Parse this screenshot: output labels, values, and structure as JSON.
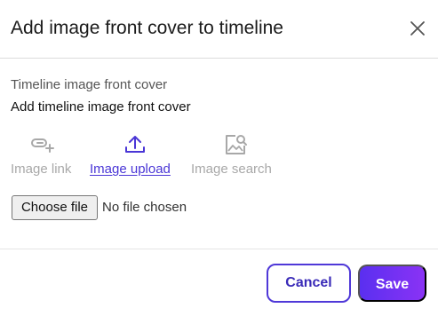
{
  "dialog": {
    "title": "Add image front cover to timeline",
    "close_icon": "close-icon"
  },
  "section": {
    "label": "Timeline image front cover",
    "description": "Add timeline image front cover"
  },
  "tabs": [
    {
      "label": "Image link",
      "icon": "link-add-icon",
      "active": false
    },
    {
      "label": "Image upload",
      "icon": "upload-icon",
      "active": true
    },
    {
      "label": "Image search",
      "icon": "image-search-icon",
      "active": false
    }
  ],
  "file_input": {
    "button_label": "Choose file",
    "status": "No file chosen"
  },
  "footer": {
    "cancel_label": "Cancel",
    "save_label": "Save"
  },
  "colors": {
    "accent": "#4a36d6",
    "save_gradient_start": "#5a2ff0",
    "save_gradient_end": "#8a33f5",
    "inactive_text": "#a8a8a8"
  }
}
